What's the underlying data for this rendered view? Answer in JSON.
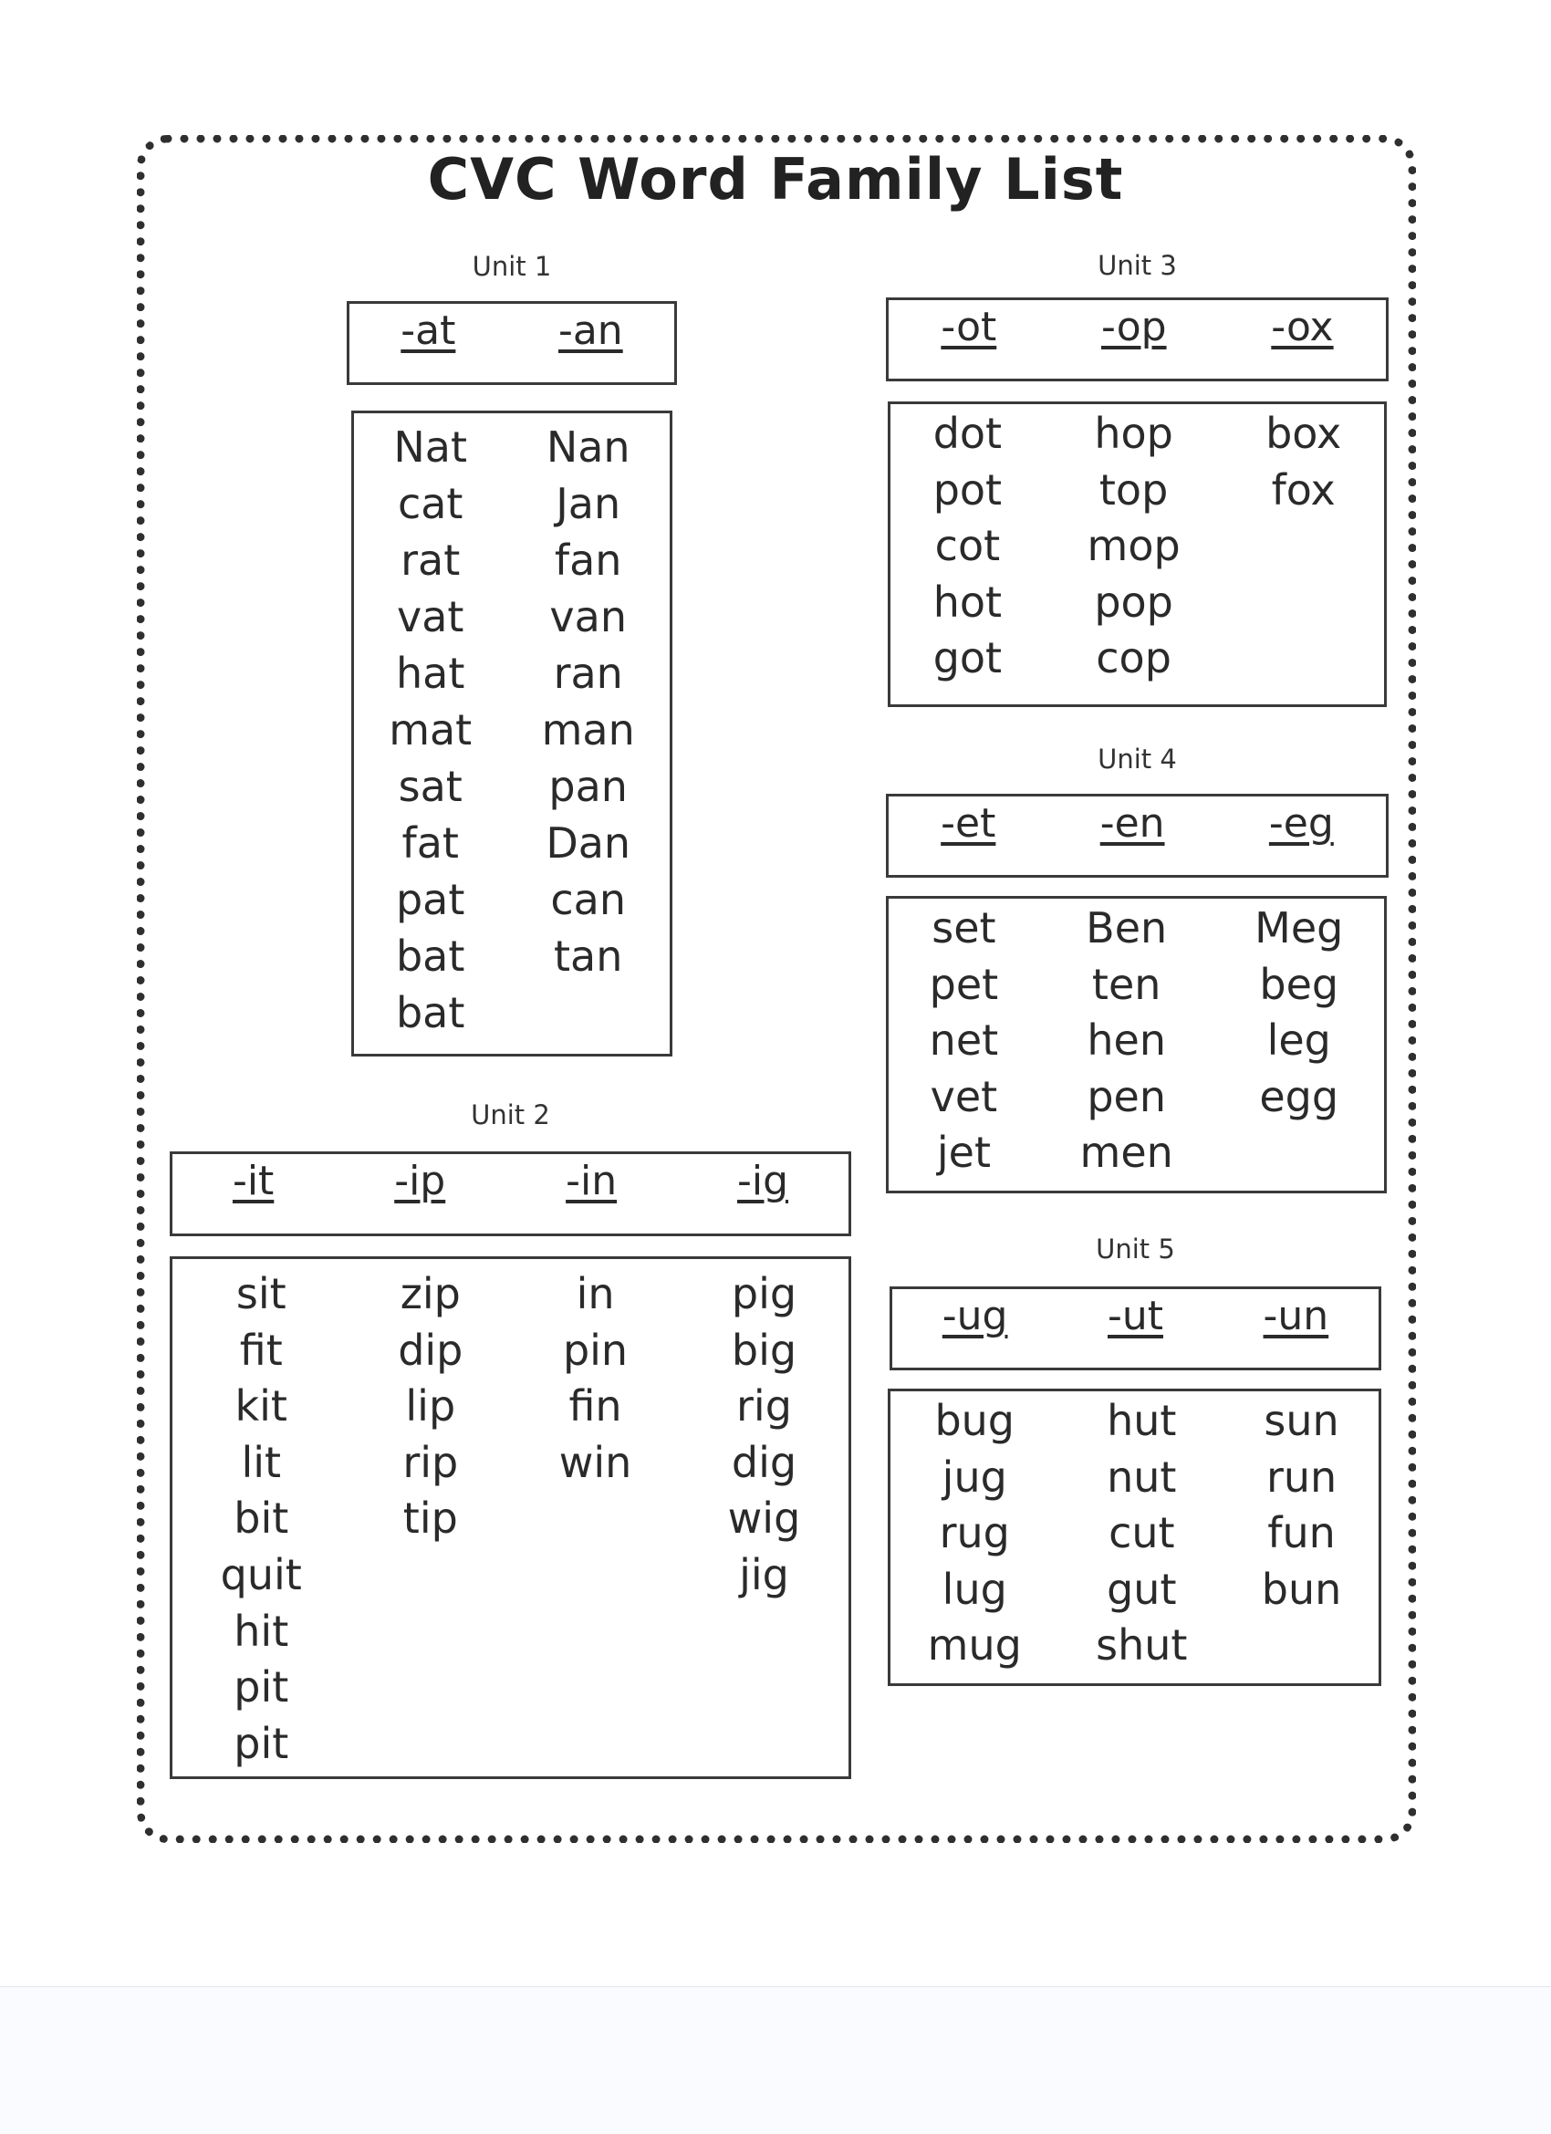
{
  "title": "CVC Word Family List",
  "units": {
    "unit1": {
      "label": "Unit 1",
      "families": [
        "-at",
        "-an"
      ],
      "columns": [
        [
          "Nat",
          "cat",
          "rat",
          "vat",
          "hat",
          "mat",
          "sat",
          "fat",
          "pat",
          "bat",
          "bat"
        ],
        [
          "Nan",
          "Jan",
          "fan",
          "van",
          "ran",
          "man",
          "pan",
          "Dan",
          "can",
          "tan"
        ]
      ]
    },
    "unit2": {
      "label": "Unit 2",
      "families": [
        "-it",
        "-ip",
        "-in",
        "-ig"
      ],
      "columns": [
        [
          "sit",
          "fit",
          "kit",
          "lit",
          "bit",
          "quit",
          "hit",
          "pit",
          "pit"
        ],
        [
          "zip",
          "dip",
          "lip",
          "rip",
          "tip"
        ],
        [
          "in",
          "pin",
          "fin",
          "win"
        ],
        [
          "pig",
          "big",
          "rig",
          "dig",
          "wig",
          "jig"
        ]
      ]
    },
    "unit3": {
      "label": "Unit 3",
      "families": [
        "-ot",
        "-op",
        "-ox"
      ],
      "columns": [
        [
          "dot",
          "pot",
          "cot",
          "hot",
          "got"
        ],
        [
          "hop",
          "top",
          "mop",
          "pop",
          "cop"
        ],
        [
          "box",
          "fox"
        ]
      ]
    },
    "unit4": {
      "label": "Unit 4",
      "families": [
        "-et",
        "-en",
        "-eg"
      ],
      "columns": [
        [
          "set",
          "pet",
          "net",
          "vet",
          "jet"
        ],
        [
          "Ben",
          "ten",
          "hen",
          "pen",
          "men"
        ],
        [
          "Meg",
          "beg",
          "leg",
          "egg"
        ]
      ]
    },
    "unit5": {
      "label": "Unit 5",
      "families": [
        "-ug",
        "-ut",
        "-un"
      ],
      "columns": [
        [
          "bug",
          "jug",
          "rug",
          "lug",
          "mug"
        ],
        [
          "hut",
          "nut",
          "cut",
          "gut",
          "shut"
        ],
        [
          "sun",
          "run",
          "fun",
          "bun"
        ]
      ]
    }
  }
}
